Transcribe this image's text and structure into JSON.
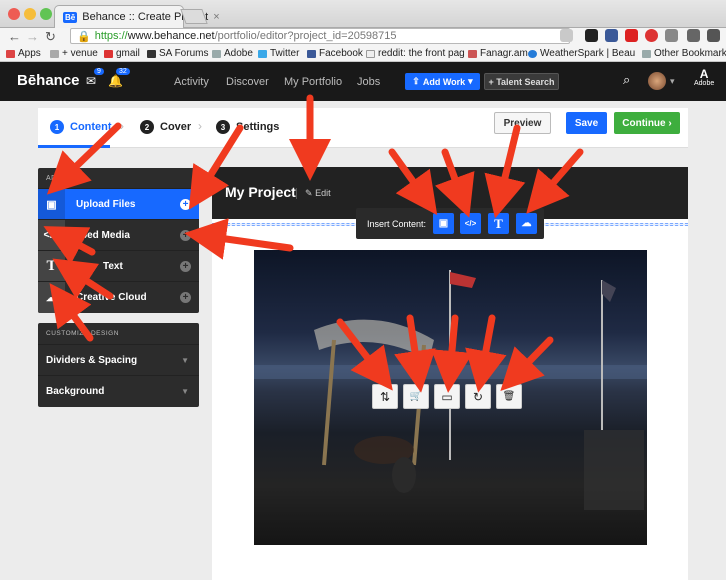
{
  "browser": {
    "tab_title": "Behance :: Create Project",
    "tab_favicon": "Bē",
    "url_scheme": "https://",
    "url_host": "www.behance.net",
    "url_path": "/portfolio/editor?project_id=20598715",
    "bookmarks": [
      "Apps",
      "+ venue",
      "gmail",
      "SA Forums",
      "Adobe",
      "Twitter",
      "Facebook",
      "reddit: the front pag",
      "Fanagr.am",
      "WeatherSpark | Beau"
    ],
    "other_bookmarks": "Other Bookmarks"
  },
  "nav": {
    "logo": "Bēhance",
    "message_count": "9",
    "notification_count": "32",
    "links": [
      "Activity",
      "Discover",
      "My Portfolio",
      "Jobs"
    ],
    "add_work": "Add Work",
    "talent_search": "+ Talent Search",
    "adobe_label": "Adobe"
  },
  "steps": [
    {
      "num": "1",
      "label": "Content"
    },
    {
      "num": "2",
      "label": "Cover"
    },
    {
      "num": "3",
      "label": "Settings"
    }
  ],
  "actions": {
    "preview": "Preview",
    "save": "Save",
    "continue": "Continue"
  },
  "sidebar": {
    "header": "ADD M",
    "items": [
      {
        "label": "Upload Files",
        "icon": "image-icon",
        "glyph": "▣"
      },
      {
        "label": "bed Media",
        "icon": "code-icon",
        "glyph": "</>"
      },
      {
        "label": "Text",
        "icon": "text-icon",
        "glyph": "T"
      },
      {
        "label": "Creative Cloud",
        "icon": "creative-cloud-icon",
        "glyph": "☁"
      }
    ],
    "customize_header": "CUSTOMIZE DESIGN",
    "customize_items": [
      "Dividers & Spacing",
      "Background"
    ]
  },
  "project": {
    "title": "My Project",
    "edit_label": "Edit",
    "insert_label": "Insert Content:",
    "insert_buttons": [
      "image-icon",
      "code-icon",
      "text-icon",
      "creative-cloud-icon"
    ],
    "image_tools": [
      {
        "icon": "reorder-icon",
        "glyph": "⇅"
      },
      {
        "icon": "cart-icon",
        "glyph": "🛒"
      },
      {
        "icon": "caption-icon",
        "glyph": "▭"
      },
      {
        "icon": "rotate-icon",
        "glyph": "↻"
      },
      {
        "icon": "trash-icon",
        "glyph": "🗑"
      }
    ]
  },
  "colors": {
    "brand_blue": "#1769ff",
    "continue_green": "#3eae3e",
    "arrow_red": "#f03a1f"
  }
}
